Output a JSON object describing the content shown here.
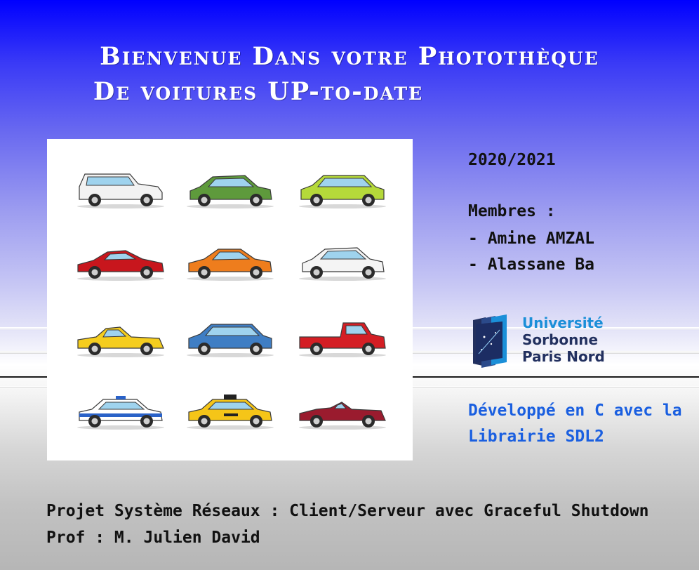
{
  "header": {
    "line1": "Bienvenue Dans votre Photothèque",
    "line2": "De voitures UP-to-date"
  },
  "info": {
    "year": "2020/2021",
    "members_title": "Membres :",
    "members": [
      "- Amine AMZAL",
      "- Alassane Ba"
    ],
    "developed_line1": "Développé en C avec la",
    "developed_line2": "Librairie SDL2"
  },
  "logo": {
    "line1": "Université",
    "line2": "Sorbonne",
    "line3": "Paris Nord",
    "accent": "#1b8fd8",
    "dark": "#22305f"
  },
  "footer": {
    "project": "Projet Système Réseaux : Client/Serveur avec Graceful Shutdown",
    "prof": "Prof : M. Julien David"
  },
  "cars": [
    {
      "kind": "suv",
      "color": "#f2f2f2"
    },
    {
      "kind": "hatch",
      "color": "#5e9a3c"
    },
    {
      "kind": "wagon",
      "color": "#b5d93a"
    },
    {
      "kind": "sport",
      "color": "#c8161d"
    },
    {
      "kind": "coupe",
      "color": "#ee7d1d"
    },
    {
      "kind": "hatch",
      "color": "#f4f4f4"
    },
    {
      "kind": "roadster",
      "color": "#f5cd1e"
    },
    {
      "kind": "wagon",
      "color": "#3f7ec4"
    },
    {
      "kind": "pickup",
      "color": "#d41e24"
    },
    {
      "kind": "police",
      "color": "#ffffff"
    },
    {
      "kind": "taxi",
      "color": "#f5c518"
    },
    {
      "kind": "convertible",
      "color": "#9a1b2e"
    }
  ]
}
